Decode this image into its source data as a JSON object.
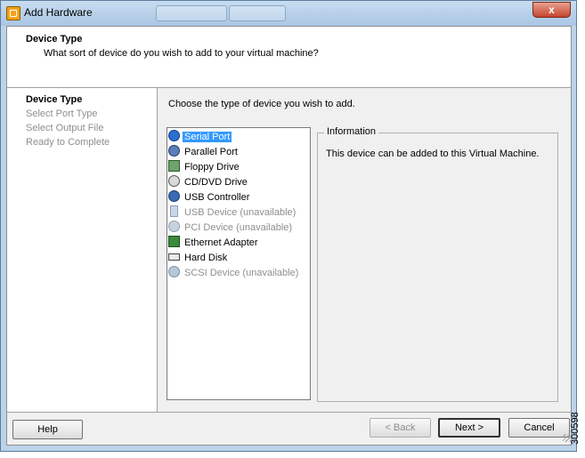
{
  "window": {
    "title": "Add Hardware",
    "close_label": "x"
  },
  "header": {
    "title": "Device Type",
    "subtitle": "What sort of device do you wish to add to your virtual machine?"
  },
  "steps": [
    {
      "label": "Device Type",
      "active": true
    },
    {
      "label": "Select Port Type",
      "active": false
    },
    {
      "label": "Select Output File",
      "active": false
    },
    {
      "label": "Ready to Complete",
      "active": false
    }
  ],
  "main": {
    "instruction": "Choose the type of device you wish to add.",
    "devices": [
      {
        "label": "Serial Port",
        "icon": "serial-port-icon",
        "state": "selected"
      },
      {
        "label": "Parallel Port",
        "icon": "parallel-port-icon",
        "state": "enabled"
      },
      {
        "label": "Floppy Drive",
        "icon": "floppy-drive-icon",
        "state": "enabled"
      },
      {
        "label": "CD/DVD Drive",
        "icon": "cd-dvd-drive-icon",
        "state": "enabled"
      },
      {
        "label": "USB Controller",
        "icon": "usb-controller-icon",
        "state": "enabled"
      },
      {
        "label": "USB Device (unavailable)",
        "icon": "usb-device-icon",
        "state": "disabled"
      },
      {
        "label": "PCI Device (unavailable)",
        "icon": "pci-device-icon",
        "state": "disabled"
      },
      {
        "label": "Ethernet Adapter",
        "icon": "ethernet-adapter-icon",
        "state": "enabled"
      },
      {
        "label": "Hard Disk",
        "icon": "hard-disk-icon",
        "state": "enabled"
      },
      {
        "label": "SCSI Device (unavailable)",
        "icon": "scsi-device-icon",
        "state": "disabled"
      }
    ],
    "information": {
      "legend": "Information",
      "text": "This device can be added to this Virtual Machine."
    }
  },
  "footer": {
    "help": "Help",
    "back": "< Back",
    "next": "Next >",
    "cancel": "Cancel"
  },
  "figure_code": "300598"
}
